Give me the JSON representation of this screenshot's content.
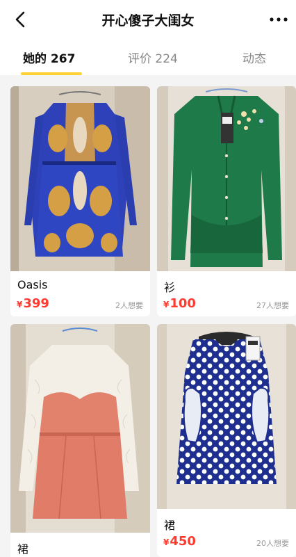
{
  "header": {
    "title": "开心傻子大闺女"
  },
  "tabs": [
    {
      "label": "她的 267"
    },
    {
      "label": "评价 224"
    },
    {
      "label": "动态"
    }
  ],
  "currency": "¥",
  "products": [
    {
      "name": "Oasis",
      "price": "399",
      "want": "2人想要"
    },
    {
      "name": "衫",
      "price": "100",
      "want": "27人想要"
    },
    {
      "name": "裙",
      "price": "",
      "want": ""
    },
    {
      "name": "裙",
      "price": "450",
      "want": "20人想要"
    }
  ],
  "colors": {
    "accent": "#ffd233",
    "price": "#ff3b30"
  },
  "icons": {
    "back": "chevron-left-icon",
    "more": "more-dots-icon"
  }
}
